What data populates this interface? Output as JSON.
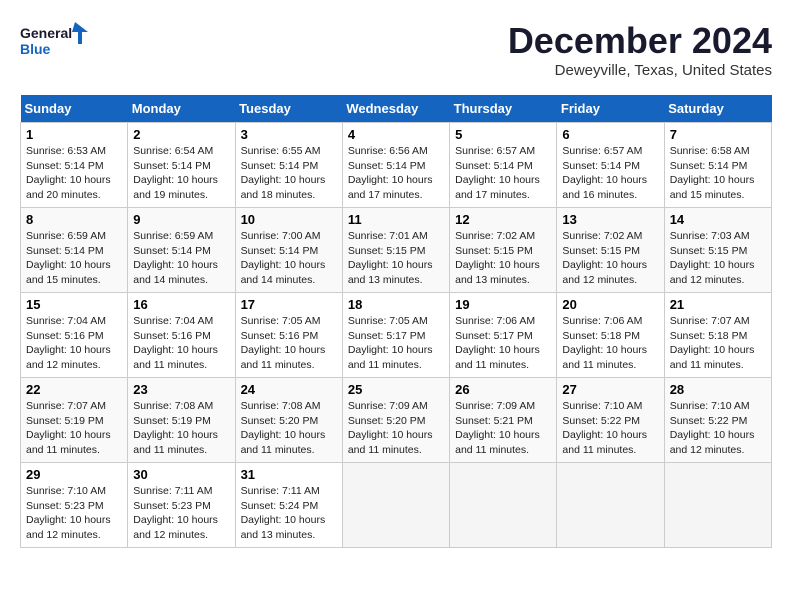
{
  "logo": {
    "line1": "General",
    "line2": "Blue"
  },
  "title": "December 2024",
  "location": "Deweyville, Texas, United States",
  "weekdays": [
    "Sunday",
    "Monday",
    "Tuesday",
    "Wednesday",
    "Thursday",
    "Friday",
    "Saturday"
  ],
  "weeks": [
    [
      {
        "day": "1",
        "sunrise": "6:53 AM",
        "sunset": "5:14 PM",
        "daylight": "10 hours and 20 minutes."
      },
      {
        "day": "2",
        "sunrise": "6:54 AM",
        "sunset": "5:14 PM",
        "daylight": "10 hours and 19 minutes."
      },
      {
        "day": "3",
        "sunrise": "6:55 AM",
        "sunset": "5:14 PM",
        "daylight": "10 hours and 18 minutes."
      },
      {
        "day": "4",
        "sunrise": "6:56 AM",
        "sunset": "5:14 PM",
        "daylight": "10 hours and 17 minutes."
      },
      {
        "day": "5",
        "sunrise": "6:57 AM",
        "sunset": "5:14 PM",
        "daylight": "10 hours and 17 minutes."
      },
      {
        "day": "6",
        "sunrise": "6:57 AM",
        "sunset": "5:14 PM",
        "daylight": "10 hours and 16 minutes."
      },
      {
        "day": "7",
        "sunrise": "6:58 AM",
        "sunset": "5:14 PM",
        "daylight": "10 hours and 15 minutes."
      }
    ],
    [
      {
        "day": "8",
        "sunrise": "6:59 AM",
        "sunset": "5:14 PM",
        "daylight": "10 hours and 15 minutes."
      },
      {
        "day": "9",
        "sunrise": "6:59 AM",
        "sunset": "5:14 PM",
        "daylight": "10 hours and 14 minutes."
      },
      {
        "day": "10",
        "sunrise": "7:00 AM",
        "sunset": "5:14 PM",
        "daylight": "10 hours and 14 minutes."
      },
      {
        "day": "11",
        "sunrise": "7:01 AM",
        "sunset": "5:15 PM",
        "daylight": "10 hours and 13 minutes."
      },
      {
        "day": "12",
        "sunrise": "7:02 AM",
        "sunset": "5:15 PM",
        "daylight": "10 hours and 13 minutes."
      },
      {
        "day": "13",
        "sunrise": "7:02 AM",
        "sunset": "5:15 PM",
        "daylight": "10 hours and 12 minutes."
      },
      {
        "day": "14",
        "sunrise": "7:03 AM",
        "sunset": "5:15 PM",
        "daylight": "10 hours and 12 minutes."
      }
    ],
    [
      {
        "day": "15",
        "sunrise": "7:04 AM",
        "sunset": "5:16 PM",
        "daylight": "10 hours and 12 minutes."
      },
      {
        "day": "16",
        "sunrise": "7:04 AM",
        "sunset": "5:16 PM",
        "daylight": "10 hours and 11 minutes."
      },
      {
        "day": "17",
        "sunrise": "7:05 AM",
        "sunset": "5:16 PM",
        "daylight": "10 hours and 11 minutes."
      },
      {
        "day": "18",
        "sunrise": "7:05 AM",
        "sunset": "5:17 PM",
        "daylight": "10 hours and 11 minutes."
      },
      {
        "day": "19",
        "sunrise": "7:06 AM",
        "sunset": "5:17 PM",
        "daylight": "10 hours and 11 minutes."
      },
      {
        "day": "20",
        "sunrise": "7:06 AM",
        "sunset": "5:18 PM",
        "daylight": "10 hours and 11 minutes."
      },
      {
        "day": "21",
        "sunrise": "7:07 AM",
        "sunset": "5:18 PM",
        "daylight": "10 hours and 11 minutes."
      }
    ],
    [
      {
        "day": "22",
        "sunrise": "7:07 AM",
        "sunset": "5:19 PM",
        "daylight": "10 hours and 11 minutes."
      },
      {
        "day": "23",
        "sunrise": "7:08 AM",
        "sunset": "5:19 PM",
        "daylight": "10 hours and 11 minutes."
      },
      {
        "day": "24",
        "sunrise": "7:08 AM",
        "sunset": "5:20 PM",
        "daylight": "10 hours and 11 minutes."
      },
      {
        "day": "25",
        "sunrise": "7:09 AM",
        "sunset": "5:20 PM",
        "daylight": "10 hours and 11 minutes."
      },
      {
        "day": "26",
        "sunrise": "7:09 AM",
        "sunset": "5:21 PM",
        "daylight": "10 hours and 11 minutes."
      },
      {
        "day": "27",
        "sunrise": "7:10 AM",
        "sunset": "5:22 PM",
        "daylight": "10 hours and 11 minutes."
      },
      {
        "day": "28",
        "sunrise": "7:10 AM",
        "sunset": "5:22 PM",
        "daylight": "10 hours and 12 minutes."
      }
    ],
    [
      {
        "day": "29",
        "sunrise": "7:10 AM",
        "sunset": "5:23 PM",
        "daylight": "10 hours and 12 minutes."
      },
      {
        "day": "30",
        "sunrise": "7:11 AM",
        "sunset": "5:23 PM",
        "daylight": "10 hours and 12 minutes."
      },
      {
        "day": "31",
        "sunrise": "7:11 AM",
        "sunset": "5:24 PM",
        "daylight": "10 hours and 13 minutes."
      },
      null,
      null,
      null,
      null
    ]
  ]
}
